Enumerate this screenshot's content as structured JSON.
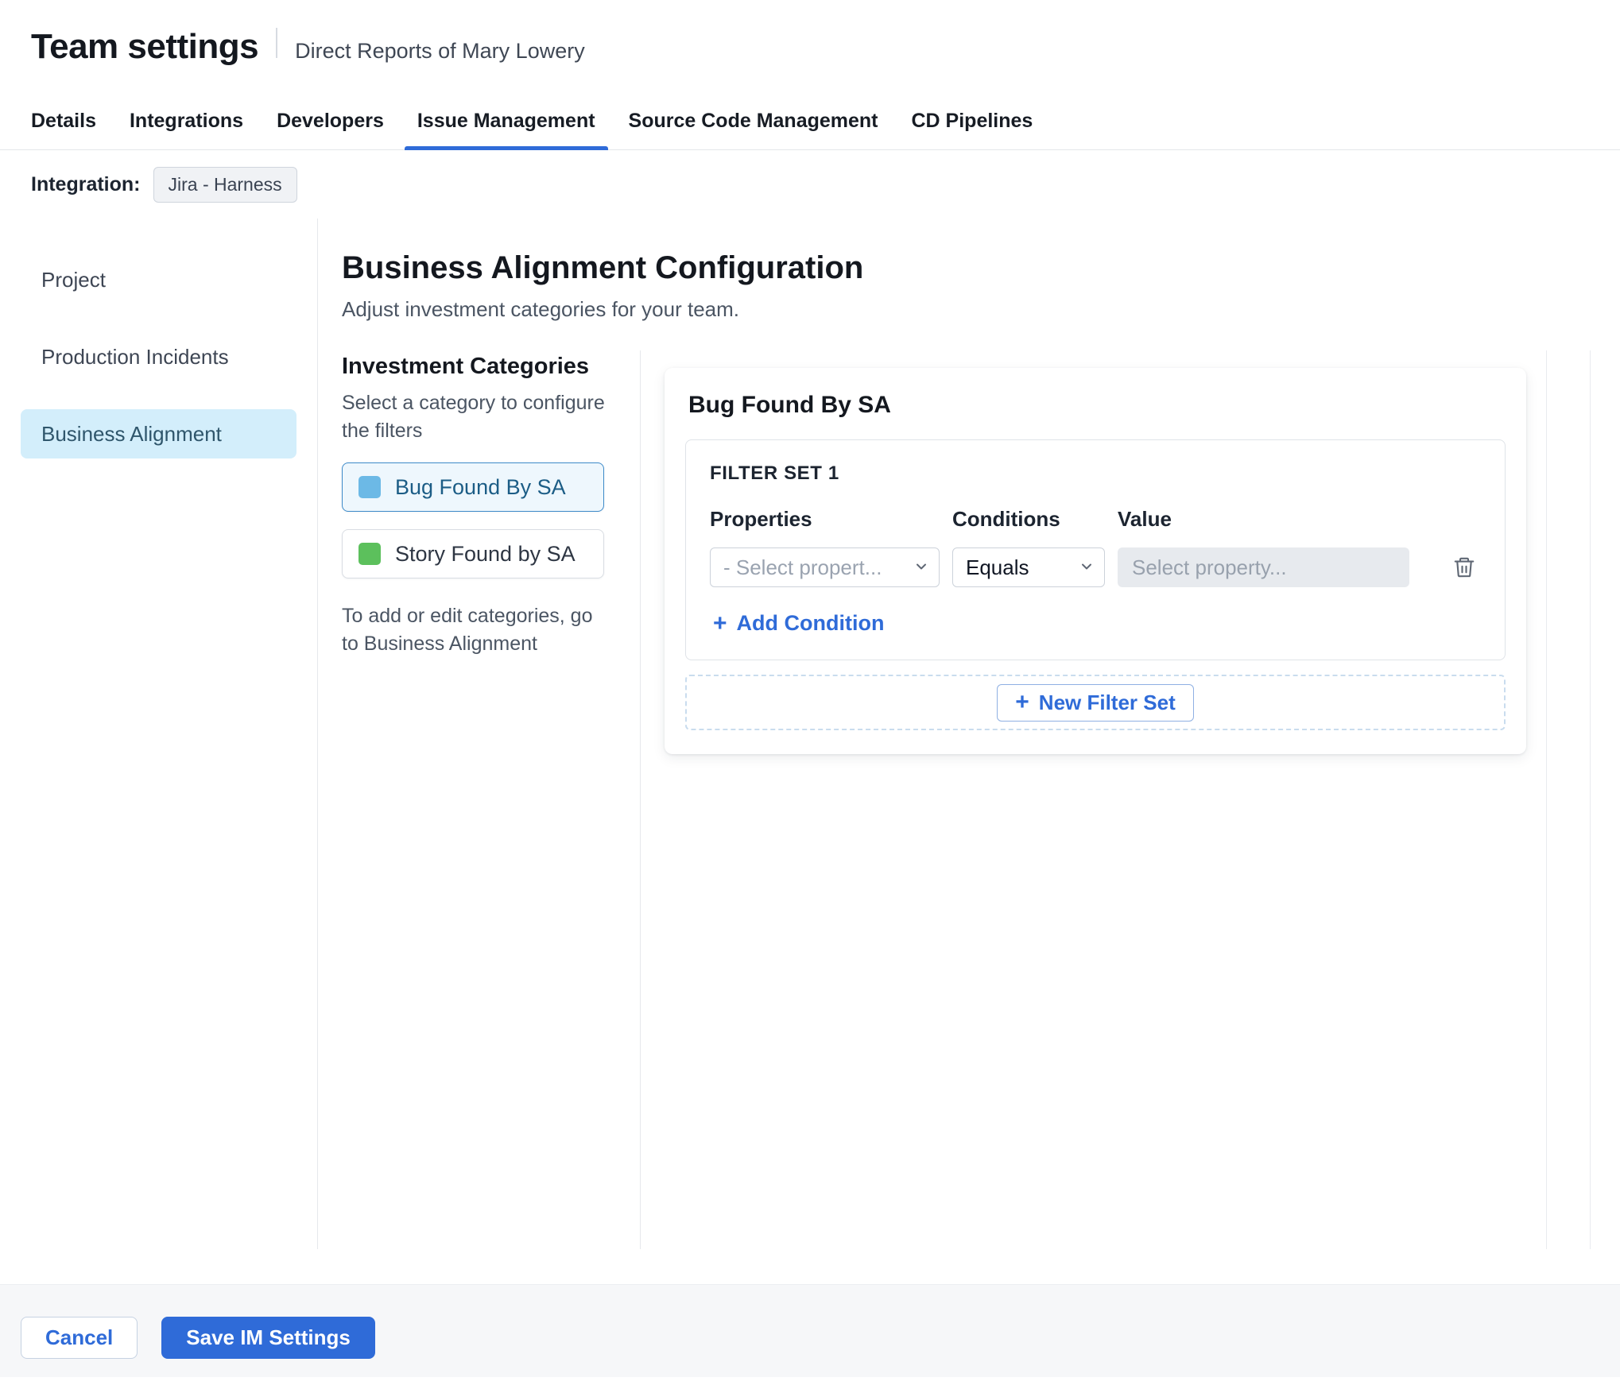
{
  "page": {
    "title": "Team settings",
    "subtitle": "Direct Reports of Mary Lowery"
  },
  "tabs": {
    "items": [
      {
        "label": "Details"
      },
      {
        "label": "Integrations"
      },
      {
        "label": "Developers"
      },
      {
        "label": "Issue Management"
      },
      {
        "label": "Source Code Management"
      },
      {
        "label": "CD Pipelines"
      }
    ]
  },
  "integration": {
    "label": "Integration:",
    "value": "Jira - Harness"
  },
  "sidebar": {
    "items": [
      {
        "label": "Project"
      },
      {
        "label": "Production Incidents"
      },
      {
        "label": "Business Alignment"
      }
    ]
  },
  "main": {
    "heading": "Business Alignment Configuration",
    "subheading": "Adjust investment categories for your team.",
    "categories": {
      "title": "Investment Categories",
      "hint": "Select a category to configure the filters",
      "items": [
        {
          "label": "Bug Found By SA",
          "swatch_color": "#6cb9e6"
        },
        {
          "label": "Story Found by SA",
          "swatch_color": "#5cc05c"
        }
      ],
      "footnote": "To add or edit categories, go to Business Alignment"
    },
    "panel": {
      "title": "Bug Found By SA",
      "filter_set": {
        "label": "FILTER SET 1",
        "columns": {
          "properties": "Properties",
          "conditions": "Conditions",
          "value": "Value"
        },
        "properties_value": "- Select propert...",
        "conditions_value": "Equals",
        "value_placeholder": "Select property...",
        "add_condition": "Add Condition"
      },
      "new_filter_set": "New Filter Set"
    }
  },
  "footer": {
    "cancel": "Cancel",
    "save": "Save IM Settings"
  },
  "icons": {
    "plus": "+"
  },
  "colors": {
    "accent": "#2f6bd8",
    "sidebar_active_bg": "#d3eefb",
    "category_selected_border": "#3d8ac9",
    "category_swatch_blue": "#6cb9e6",
    "category_swatch_green": "#5cc05c"
  }
}
